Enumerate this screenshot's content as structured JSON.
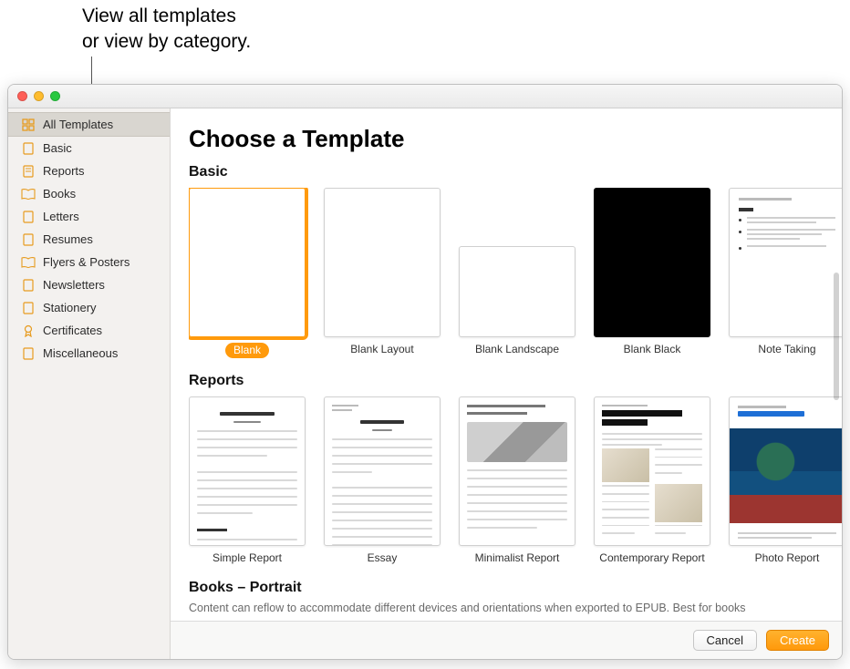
{
  "callout": {
    "line1": "View all templates",
    "line2": "or view by category."
  },
  "sidebar": {
    "items": [
      {
        "label": "All Templates",
        "icon": "grid",
        "selected": true
      },
      {
        "label": "Basic",
        "icon": "doc",
        "selected": false
      },
      {
        "label": "Reports",
        "icon": "doc",
        "selected": false
      },
      {
        "label": "Books",
        "icon": "book",
        "selected": false
      },
      {
        "label": "Letters",
        "icon": "doc",
        "selected": false
      },
      {
        "label": "Resumes",
        "icon": "doc",
        "selected": false
      },
      {
        "label": "Flyers & Posters",
        "icon": "book",
        "selected": false
      },
      {
        "label": "Newsletters",
        "icon": "doc",
        "selected": false
      },
      {
        "label": "Stationery",
        "icon": "doc",
        "selected": false
      },
      {
        "label": "Certificates",
        "icon": "cert",
        "selected": false
      },
      {
        "label": "Miscellaneous",
        "icon": "doc",
        "selected": false
      }
    ]
  },
  "page_title": "Choose a Template",
  "sections": {
    "basic": {
      "title": "Basic",
      "templates": [
        {
          "label": "Blank",
          "selected": true
        },
        {
          "label": "Blank Layout",
          "selected": false
        },
        {
          "label": "Blank Landscape",
          "selected": false
        },
        {
          "label": "Blank Black",
          "selected": false
        },
        {
          "label": "Note Taking",
          "selected": false
        }
      ]
    },
    "reports": {
      "title": "Reports",
      "templates": [
        {
          "label": "Simple Report"
        },
        {
          "label": "Essay"
        },
        {
          "label": "Minimalist Report"
        },
        {
          "label": "Contemporary Report"
        },
        {
          "label": "Photo Report"
        }
      ]
    },
    "books": {
      "title": "Books – Portrait",
      "subtitle": "Content can reflow to accommodate different devices and orientations when exported to EPUB. Best for books"
    }
  },
  "footer": {
    "cancel": "Cancel",
    "create": "Create"
  },
  "colors": {
    "accent": "#ff9a0c"
  }
}
